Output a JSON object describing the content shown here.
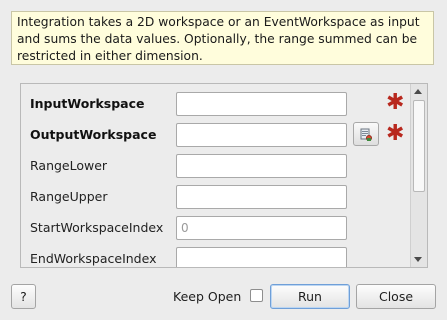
{
  "help_text": "Integration takes a 2D workspace or an EventWorkspace as input and sums the data values. Optionally, the range summed can be restricted in either dimension.",
  "properties": [
    {
      "label": "InputWorkspace",
      "value": "",
      "placeholder": "",
      "mandatory": true,
      "browse": false
    },
    {
      "label": "OutputWorkspace",
      "value": "",
      "placeholder": "",
      "mandatory": true,
      "browse": true
    },
    {
      "label": "RangeLower",
      "value": "",
      "placeholder": "",
      "mandatory": false,
      "browse": false
    },
    {
      "label": "RangeUpper",
      "value": "",
      "placeholder": "",
      "mandatory": false,
      "browse": false
    },
    {
      "label": "StartWorkspaceIndex",
      "value": "",
      "placeholder": "0",
      "mandatory": false,
      "browse": false
    },
    {
      "label": "EndWorkspaceIndex",
      "value": "",
      "placeholder": "",
      "mandatory": false,
      "browse": false
    }
  ],
  "mandatory_marker": "✱",
  "mandatory_color": "#b8281e",
  "buttons": {
    "help_label": "?",
    "keep_open_label": "Keep Open",
    "keep_open_checked": false,
    "run_label": "Run",
    "close_label": "Close"
  },
  "icons": {
    "browse": "workspace-browse-icon",
    "scroll_up": "scroll-up-arrow-icon",
    "scroll_down": "scroll-down-arrow-icon"
  }
}
